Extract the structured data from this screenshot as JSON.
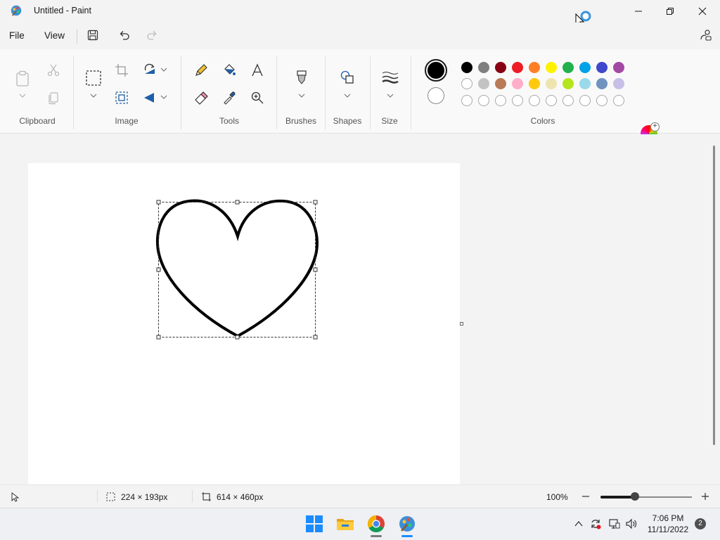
{
  "window": {
    "title": "Untitled - Paint"
  },
  "menu": {
    "file": "File",
    "view": "View"
  },
  "ribbon": {
    "groups": {
      "clipboard": "Clipboard",
      "image": "Image",
      "tools": "Tools",
      "brushes": "Brushes",
      "shapes": "Shapes",
      "size": "Size",
      "colors": "Colors"
    },
    "palette_row1": [
      "#000000",
      "#7f7f7f",
      "#880015",
      "#ed1c24",
      "#ff7f27",
      "#fff200",
      "#22b14c",
      "#00a2e8",
      "#3f48cc",
      "#a349a4"
    ],
    "palette_row2": [
      "#ffffff",
      "#c3c3c3",
      "#b97a57",
      "#ffaec9",
      "#ffc90e",
      "#efe4b0",
      "#b5e61d",
      "#99d9ea",
      "#7092be",
      "#c8bfe7"
    ],
    "palette_row3_count": 10,
    "primary_color": "#000000",
    "secondary_color": "#ffffff"
  },
  "status": {
    "selection_size": "224 × 193px",
    "canvas_size": "614 × 460px",
    "zoom": "100%",
    "zoom_fraction": 0.38
  },
  "taskbar": {
    "time": "7:06 PM",
    "date": "11/11/2022",
    "notifications": "2"
  }
}
